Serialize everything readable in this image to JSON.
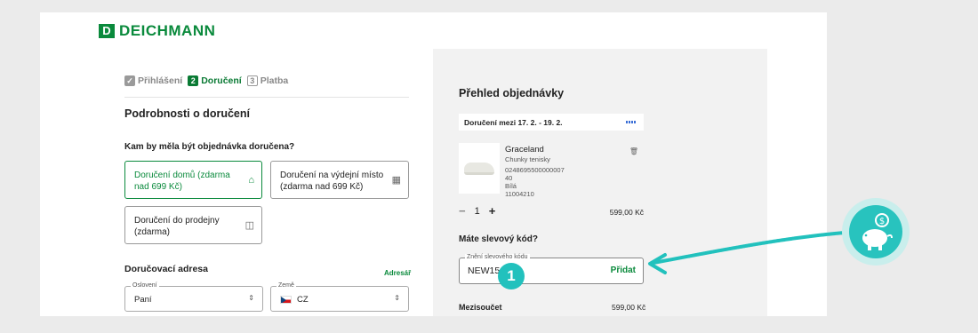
{
  "brand": {
    "logo_letter": "D",
    "name": "DEICHMANN",
    "color": "#0a8a3c"
  },
  "steps": [
    {
      "num": "✓",
      "label": "Přihlášení",
      "state": "done"
    },
    {
      "num": "2",
      "label": "Doručení",
      "state": "active"
    },
    {
      "num": "3",
      "label": "Platba",
      "state": "pending"
    }
  ],
  "delivery": {
    "heading": "Podrobnosti o doručení",
    "question": "Kam by měla být objednávka doručena?",
    "options": [
      {
        "label": "Doručení domů (zdarma nad 699 Kč)",
        "icon": "home-icon",
        "selected": true
      },
      {
        "label": "Doručení na výdejní místo (zdarma nad 699 Kč)",
        "icon": "store-icon",
        "selected": false
      },
      {
        "label": "Doručení do prodejny (zdarma)",
        "icon": "shop-bag-icon",
        "selected": false
      }
    ]
  },
  "address": {
    "heading": "Doručovací adresa",
    "link": "Adresář",
    "salutation": {
      "label": "Oslovení",
      "value": "Paní"
    },
    "country": {
      "label": "Země",
      "value": "CZ"
    }
  },
  "summary": {
    "title": "Přehled objednávky",
    "delivery_window": "Doručení mezi 17. 2. - 19. 2.",
    "product": {
      "name": "Graceland",
      "type": "Chunky tenisky",
      "code": "0248695500000007",
      "size": "40",
      "color": "Bílá",
      "sku": "11004210",
      "quantity": "1",
      "price": "599,00 Kč"
    },
    "coupon": {
      "question": "Máte slevový kód?",
      "label": "Znění slevového kódu",
      "value": "NEW15",
      "button": "Přidat"
    },
    "subtotal_label": "Mezisoučet",
    "subtotal_value": "599,00 Kč"
  },
  "callout": {
    "number": "1",
    "color": "#22c1bd"
  }
}
